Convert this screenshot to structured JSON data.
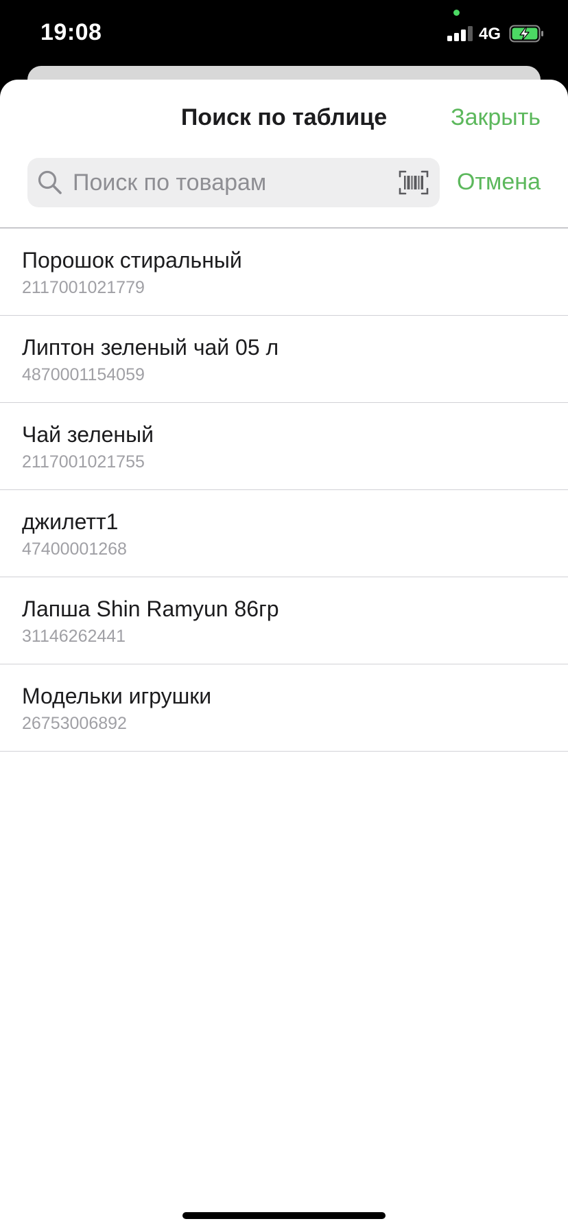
{
  "status_bar": {
    "time": "19:08",
    "network": "4G",
    "battery_charging": true,
    "privacy_indicator_color": "#4cd964",
    "signal_bars_active": 3,
    "signal_bars_total": 4
  },
  "sheet": {
    "title": "Поиск по таблице",
    "close_label": "Закрыть",
    "accent_color": "#5cb85c"
  },
  "search": {
    "placeholder": "Поиск по товарам",
    "value": "",
    "cancel_label": "Отмена",
    "search_icon": "magnifying-glass-icon",
    "scan_icon": "barcode-scanner-icon"
  },
  "results": [
    {
      "name": "Порошок стиральный",
      "code": "2117001021779"
    },
    {
      "name": "Липтон зеленый чай 05 л",
      "code": "4870001154059"
    },
    {
      "name": "Чай зеленый",
      "code": "2117001021755"
    },
    {
      "name": "джилетт1",
      "code": "47400001268"
    },
    {
      "name": "Лапша Shin Ramyun 86гр",
      "code": "31146262441"
    },
    {
      "name": "Модельки игрушки",
      "code": "26753006892"
    }
  ]
}
